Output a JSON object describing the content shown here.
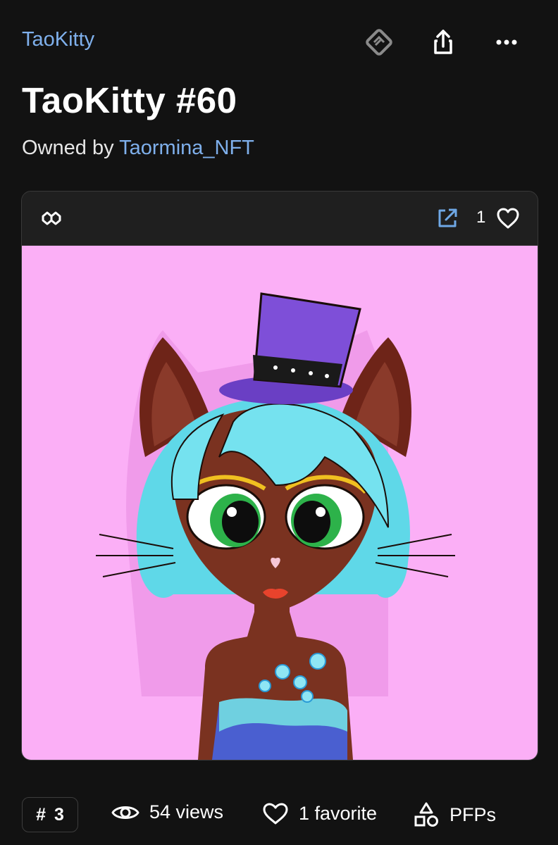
{
  "header": {
    "collection_name": "TaoKitty",
    "icons": [
      "offer-handshake-icon",
      "share-icon",
      "more-icon"
    ]
  },
  "item": {
    "title": "TaoKitty #60",
    "owned_by_prefix": "Owned by",
    "owner_name": "Taormina_NFT"
  },
  "card": {
    "chain_icon": "polygon-chain-icon",
    "external_icon": "external-link-icon",
    "favorites_count": "1",
    "heart_icon": "heart-icon",
    "background_color": "#fbaff6"
  },
  "stats": {
    "rank_symbol": "#",
    "rank_value": "3",
    "views_text": "54 views",
    "favorites_text": "1 favorite",
    "category_text": "PFPs"
  },
  "colors": {
    "page_background": "#121212",
    "accent_link": "#7fb0ec",
    "card_background": "#1f1f1f"
  }
}
